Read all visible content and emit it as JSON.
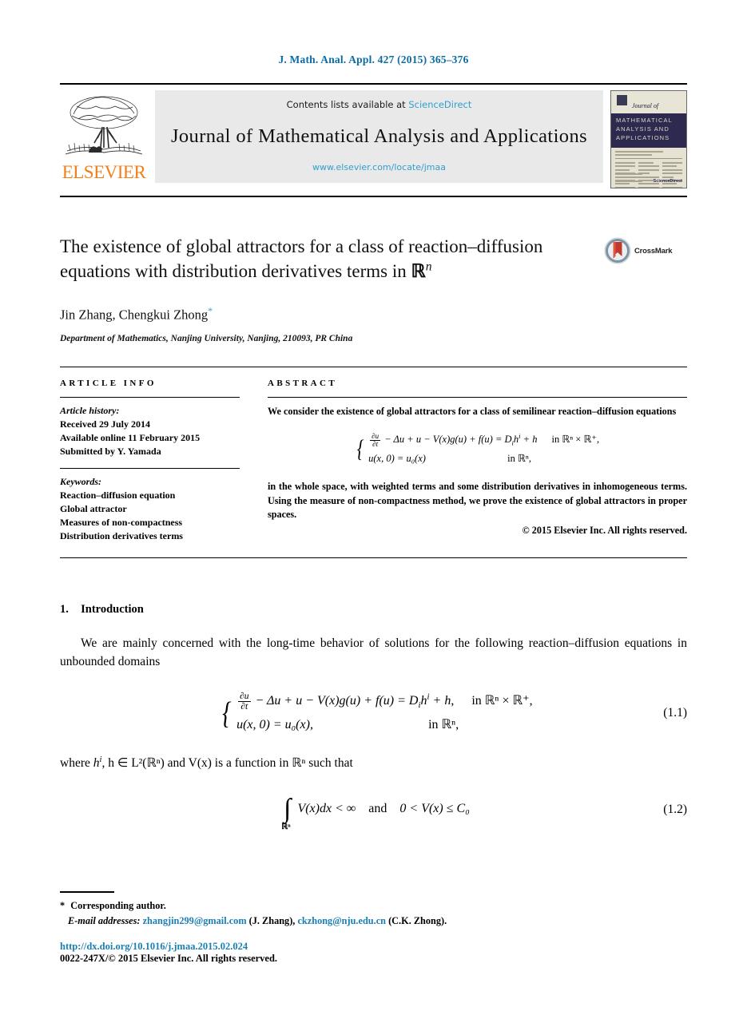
{
  "running_head": "J. Math. Anal. Appl. 427 (2015) 365–376",
  "masthead": {
    "contents_prefix": "Contents lists available at",
    "sciencedirect": "ScienceDirect",
    "journal_title": "Journal of Mathematical Analysis and Applications",
    "journal_url": "www.elsevier.com/locate/jmaa",
    "publisher_wordmark": "ELSEVIER",
    "cover": {
      "script_line": "Journal of",
      "band_line1": "MATHEMATICAL",
      "band_line2": "ANALYSIS AND",
      "band_line3": "APPLICATIONS",
      "footer_mark": "ScienceDirect"
    }
  },
  "article": {
    "title": "The existence of global attractors for a class of reaction–diffusion equations with distribution derivatives terms in ℝⁿ",
    "title_line1": "The existence of global attractors for a class of reaction–diffusion",
    "title_line2_pre": "equations with distribution derivatives terms in ",
    "title_line2_math": "ℝ",
    "title_line2_sup": "n",
    "authors": "Jin Zhang, Chengkui Zhong",
    "corresponding_marker": "*",
    "affiliation": "Department of Mathematics, Nanjing University, Nanjing, 210093, PR China",
    "crossmark_label": "CrossMark"
  },
  "article_info": {
    "heading": "ARTICLE INFO",
    "history_title": "Article history:",
    "history": [
      "Received 29 July 2014",
      "Available online 11 February 2015",
      "Submitted by Y. Yamada"
    ],
    "keywords_title": "Keywords:",
    "keywords": [
      "Reaction–diffusion equation",
      "Global attractor",
      "Measures of non-compactness",
      "Distribution derivatives terms"
    ]
  },
  "abstract": {
    "heading": "ABSTRACT",
    "para1": "We consider the existence of global attractors for a class of semilinear reaction–diffusion equations",
    "equation": {
      "line1_lhs_frac_num": "∂u",
      "line1_lhs_frac_den": "∂t",
      "line1_rest": "− Δu + u − V(x)g(u) + f(u) = D",
      "line1_sub": "i",
      "line1_h": "h",
      "line1_hsup": "i",
      "line1_tail": "+ h",
      "line1_cond": "in ℝⁿ × ℝ⁺,",
      "line2": "u(x, 0) = u₀(x)",
      "line2_cond": "in ℝⁿ,"
    },
    "para2": "in the whole space, with weighted terms and some distribution derivatives in inhomogeneous terms. Using the measure of non-compactness method, we prove the existence of global attractors in proper spaces.",
    "copyright": "© 2015 Elsevier Inc. All rights reserved."
  },
  "body": {
    "section_number": "1.",
    "section_title": "Introduction",
    "paragraph1": "We are mainly concerned with the long-time behavior of solutions for the following reaction–diffusion equations in unbounded domains",
    "equation_1_1": {
      "number": "(1.1)",
      "line1_cond": "in ℝⁿ × ℝ⁺,",
      "line2": "u(x, 0) = u₀(x),",
      "line2_cond": "in ℝⁿ,"
    },
    "paragraph2_pre": "where ",
    "paragraph2_math1": "h",
    "paragraph2_sup1": "i",
    "paragraph2_mid": ", h ∈ L²(ℝⁿ) and V(x) is a function in ℝⁿ such that",
    "equation_1_2": {
      "number": "(1.2)",
      "integral_limit": "ℝⁿ",
      "integrand": "V(x)dx < ∞",
      "conjunction": "and",
      "bound": "0 < V(x) ≤ C₀"
    }
  },
  "footnotes": {
    "corresponding_marker": "*",
    "corresponding_text": "Corresponding author.",
    "email_label": "E-mail addresses:",
    "email1": "zhangjin299@gmail.com",
    "email1_owner": "(J. Zhang),",
    "email2": "ckzhong@nju.edu.cn",
    "email2_owner": "(C.K. Zhong).",
    "doi": "http://dx.doi.org/10.1016/j.jmaa.2015.02.024",
    "issn_line": "0022-247X/© 2015 Elsevier Inc. All rights reserved."
  },
  "colors": {
    "link_blue": "#1a7fb5",
    "sciencedirect_blue": "#2f9fd0",
    "elsevier_orange": "#F07F1A",
    "cover_navy": "#2e2a4f",
    "crossmark_red": "#c0392b"
  }
}
